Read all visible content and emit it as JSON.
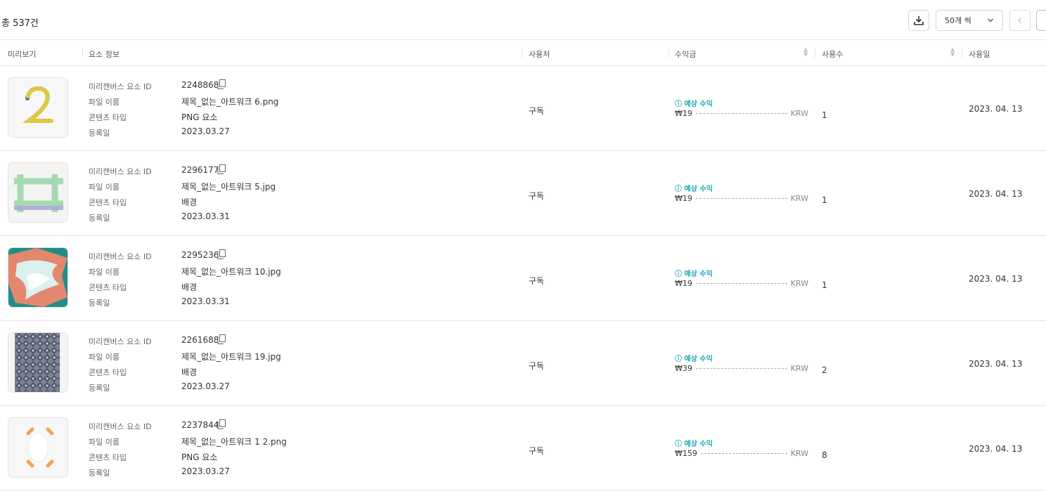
{
  "header": {
    "total_text": "총 537건",
    "per_page_label": "50개 씩"
  },
  "columns": {
    "preview": "미리보기",
    "element_info": "요소 정보",
    "usage_place": "사용처",
    "revenue": "수익금",
    "usage_count": "사용수",
    "usage_date": "사용일"
  },
  "labels": {
    "element_id": "미리캔버스 요소 ID",
    "file_name": "파일 이름",
    "content_type": "콘텐츠 타입",
    "registered": "등록일",
    "expected_revenue": "ⓘ 예상 수익",
    "currency": "KRW"
  },
  "rows": [
    {
      "id": "2248868",
      "file": "제목_없는_아트워크 6.png",
      "type": "PNG 요소",
      "registered": "2023.03.27",
      "usage": "구독",
      "revenue": "₩19",
      "count": "1",
      "date": "2023. 04. 13"
    },
    {
      "id": "2296177",
      "file": "제목_없는_아트워크 5.jpg",
      "type": "배경",
      "registered": "2023.03.31",
      "usage": "구독",
      "revenue": "₩19",
      "count": "1",
      "date": "2023. 04. 13"
    },
    {
      "id": "2295236",
      "file": "제목_없는_아트워크 10.jpg",
      "type": "배경",
      "registered": "2023.03.31",
      "usage": "구독",
      "revenue": "₩19",
      "count": "1",
      "date": "2023. 04. 13"
    },
    {
      "id": "2261688",
      "file": "제목_없는_아트워크 19.jpg",
      "type": "배경",
      "registered": "2023.03.27",
      "usage": "구독",
      "revenue": "₩39",
      "count": "2",
      "date": "2023. 04. 13"
    },
    {
      "id": "2237844",
      "file": "제목_없는_아트워크 1 2.png",
      "type": "PNG 요소",
      "registered": "2023.03.27",
      "usage": "구독",
      "revenue": "₩159",
      "count": "8",
      "date": "2023. 04. 13"
    }
  ]
}
